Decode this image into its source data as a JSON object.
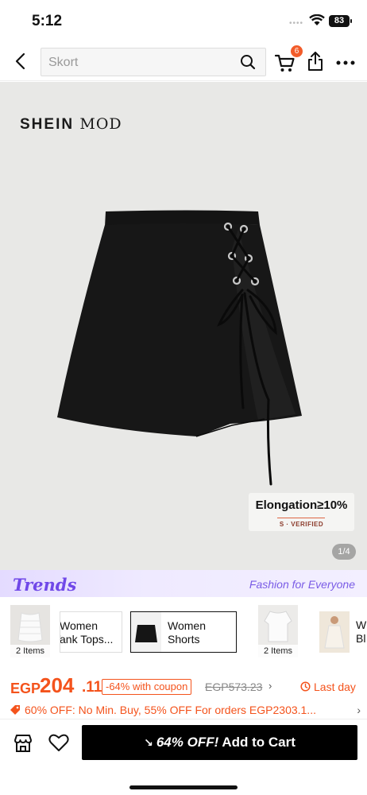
{
  "status": {
    "time": "5:12",
    "battery": "83"
  },
  "search": {
    "placeholder": "Skort"
  },
  "header": {
    "cart_count": "6"
  },
  "product": {
    "brand": "SHEIN",
    "brand_suffix": "MOD",
    "badge_title": "Elongation≥10%",
    "badge_verified": "S · VERIFIED",
    "image_counter": "1/4",
    "image_index": 1,
    "image_total": 4
  },
  "trends": {
    "logo": "Trends",
    "slogan": "Fashion for Everyone"
  },
  "categories": [
    {
      "label": "Women\nTank Tops...",
      "count": "2 Items"
    },
    {
      "label": "Women\nShorts",
      "selected": true
    },
    {
      "label": "Women\nBl...",
      "count": "2 Items"
    }
  ],
  "category_labels": {
    "tank_1": "Women",
    "tank_2": "Tank Tops...",
    "shorts_1": "Women",
    "shorts_2": "Shorts",
    "blouse_1": "W",
    "blouse_2": "Bl",
    "count_a": "2 Items",
    "count_b": "2 Items"
  },
  "price": {
    "currency": "EGP",
    "amount": "204",
    "decimals": ".11",
    "coupon": "-64% with coupon",
    "original": "EGP573.23",
    "last_day": "Last day"
  },
  "promo": {
    "text": "60% OFF: No Min. Buy,  55% OFF For orders EGP2303.1..."
  },
  "cta": {
    "discount": "64% OFF!",
    "label": "Add to Cart"
  },
  "colors": {
    "accent": "#f4531c",
    "trends": "#7048e8",
    "cta_bg": "#000000"
  }
}
